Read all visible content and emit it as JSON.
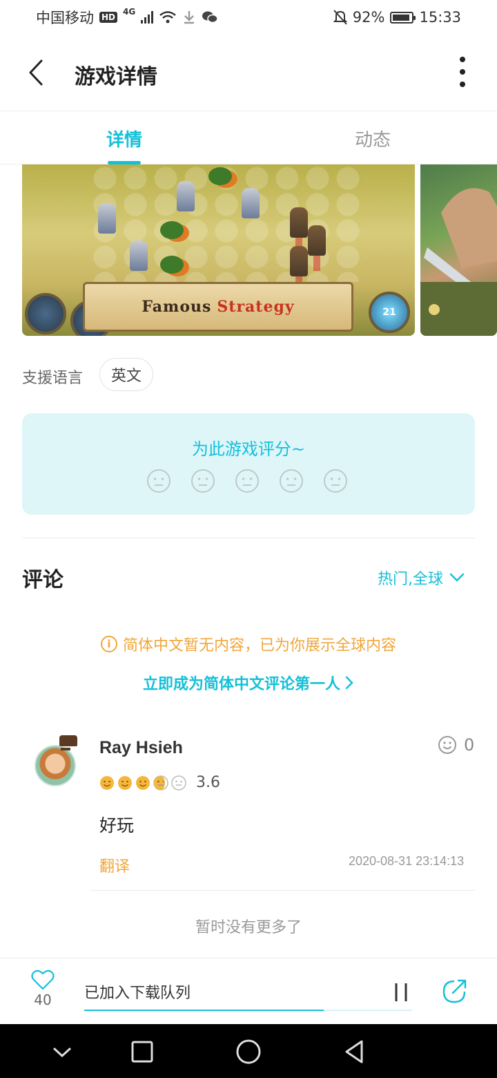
{
  "status_bar": {
    "carrier": "中国移动",
    "hd": "HD",
    "network": "4G",
    "battery": "92%",
    "time": "15:33"
  },
  "header": {
    "title": "游戏详情",
    "back_icon": "chevron-left-icon",
    "more_icon": "more-vertical-icon"
  },
  "tabs": [
    {
      "label": "详情",
      "active": true
    },
    {
      "label": "动态",
      "active": false
    }
  ],
  "gallery": {
    "banner_word_1": "Famous",
    "banner_word_2": "Strategy",
    "badge": "21"
  },
  "language": {
    "label": "支援语言",
    "value": "英文"
  },
  "rating_prompt": {
    "title": "为此游戏评分~",
    "faces": 5
  },
  "comments": {
    "title": "评论",
    "filter": "热门,全球",
    "notice": "简体中文暂无内容，已为你展示全球内容",
    "first_link": "立即成为简体中文评论第一人",
    "items": [
      {
        "author": "Ray Hsieh",
        "rating": "3.6",
        "likes": "0",
        "text": "好玩",
        "translate": "翻译",
        "time": "2020-08-31 23:14:13"
      }
    ],
    "no_more": "暂时没有更多了"
  },
  "bottom_bar": {
    "favorites": "40",
    "download_status": "已加入下载队列",
    "progress": 0.73
  },
  "colors": {
    "accent": "#14c0d8",
    "warning": "#f0a63a",
    "rating_bg": "#dff6f9",
    "star": "#f5b73b"
  }
}
